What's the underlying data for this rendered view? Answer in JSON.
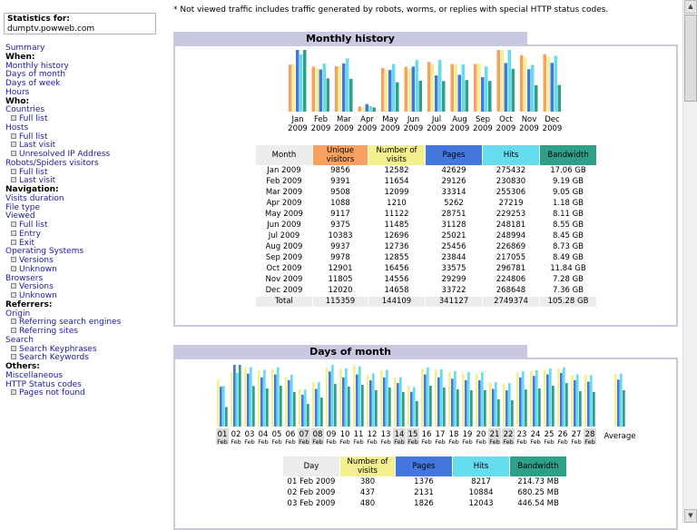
{
  "sidebar": {
    "stats_label": "Statistics for:",
    "site": "dumptv.powweb.com",
    "menu": [
      {
        "type": "link",
        "text": "Summary"
      },
      {
        "type": "head",
        "text": "When:"
      },
      {
        "type": "link",
        "text": "Monthly history"
      },
      {
        "type": "link",
        "text": "Days of month"
      },
      {
        "type": "link",
        "text": "Days of week"
      },
      {
        "type": "link",
        "text": "Hours"
      },
      {
        "type": "head",
        "text": "Who:"
      },
      {
        "type": "link",
        "text": "Countries"
      },
      {
        "type": "sub",
        "text": "Full list"
      },
      {
        "type": "link",
        "text": "Hosts"
      },
      {
        "type": "sub",
        "text": "Full list"
      },
      {
        "type": "sub",
        "text": "Last visit"
      },
      {
        "type": "sub",
        "text": "Unresolved IP Address"
      },
      {
        "type": "link",
        "text": "Robots/Spiders visitors"
      },
      {
        "type": "sub",
        "text": "Full list"
      },
      {
        "type": "sub",
        "text": "Last visit"
      },
      {
        "type": "head",
        "text": "Navigation:"
      },
      {
        "type": "link",
        "text": "Visits duration"
      },
      {
        "type": "link",
        "text": "File type"
      },
      {
        "type": "link",
        "text": "Viewed"
      },
      {
        "type": "sub",
        "text": "Full list"
      },
      {
        "type": "sub",
        "text": "Entry"
      },
      {
        "type": "sub",
        "text": "Exit"
      },
      {
        "type": "link",
        "text": "Operating Systems"
      },
      {
        "type": "sub",
        "text": "Versions"
      },
      {
        "type": "sub",
        "text": "Unknown"
      },
      {
        "type": "link",
        "text": "Browsers"
      },
      {
        "type": "sub",
        "text": "Versions"
      },
      {
        "type": "sub",
        "text": "Unknown"
      },
      {
        "type": "head",
        "text": "Referrers:"
      },
      {
        "type": "link",
        "text": "Origin"
      },
      {
        "type": "sub",
        "text": "Referring search engines"
      },
      {
        "type": "sub",
        "text": "Referring sites"
      },
      {
        "type": "link",
        "text": "Search"
      },
      {
        "type": "sub",
        "text": "Search Keyphrases"
      },
      {
        "type": "sub",
        "text": "Search Keywords"
      },
      {
        "type": "head",
        "text": "Others:"
      },
      {
        "type": "link",
        "text": "Miscellaneous"
      },
      {
        "type": "link",
        "text": "HTTP Status codes"
      },
      {
        "type": "sub",
        "text": "Pages not found"
      }
    ]
  },
  "note": "* Not viewed traffic includes traffic generated by robots, worms, or replies with special HTTP status codes.",
  "monthly": {
    "title": "Monthly history",
    "headers": [
      "Month",
      "Unique visitors",
      "Number of visits",
      "Pages",
      "Hits",
      "Bandwidth"
    ],
    "rows": [
      [
        "Jan 2009",
        "9856",
        "12582",
        "42629",
        "275432",
        "17.06 GB"
      ],
      [
        "Feb 2009",
        "9391",
        "11654",
        "29126",
        "230830",
        "9.19 GB"
      ],
      [
        "Mar 2009",
        "9508",
        "12099",
        "33314",
        "255306",
        "9.05 GB"
      ],
      [
        "Apr 2009",
        "1088",
        "1210",
        "5262",
        "27219",
        "1.18 GB"
      ],
      [
        "May 2009",
        "9117",
        "11122",
        "28751",
        "229253",
        "8.11 GB"
      ],
      [
        "Jun 2009",
        "9375",
        "11485",
        "31128",
        "248181",
        "8.55 GB"
      ],
      [
        "Jul 2009",
        "10383",
        "12696",
        "25021",
        "248994",
        "8.45 GB"
      ],
      [
        "Aug 2009",
        "9937",
        "12736",
        "25456",
        "226869",
        "8.73 GB"
      ],
      [
        "Sep 2009",
        "9978",
        "12855",
        "23844",
        "217055",
        "8.49 GB"
      ],
      [
        "Oct 2009",
        "12901",
        "16456",
        "33575",
        "296781",
        "11.84 GB"
      ],
      [
        "Nov 2009",
        "11805",
        "14556",
        "29299",
        "224806",
        "7.28 GB"
      ],
      [
        "Dec 2009",
        "12020",
        "14658",
        "33722",
        "268648",
        "7.36 GB"
      ]
    ],
    "total": [
      "Total",
      "115359",
      "144109",
      "341127",
      "2749374",
      "105.28 GB"
    ]
  },
  "days": {
    "title": "Days of month",
    "headers": [
      "Day",
      "Number of visits",
      "Pages",
      "Hits",
      "Bandwidth"
    ],
    "rows": [
      [
        "01 Feb 2009",
        "380",
        "1376",
        "8217",
        "214.73 MB"
      ],
      [
        "02 Feb 2009",
        "437",
        "2131",
        "10884",
        "680.25 MB"
      ],
      [
        "03 Feb 2009",
        "480",
        "1826",
        "12043",
        "446.54 MB"
      ]
    ],
    "average_label": "Average"
  },
  "chart_data": [
    {
      "type": "bar",
      "title": "Monthly history",
      "categories": [
        "Jan 2009",
        "Feb 2009",
        "Mar 2009",
        "Apr 2009",
        "May 2009",
        "Jun 2009",
        "Jul 2009",
        "Aug 2009",
        "Sep 2009",
        "Oct 2009",
        "Nov 2009",
        "Dec 2009"
      ],
      "series": [
        {
          "name": "Unique visitors",
          "color": "#f8a060",
          "values": [
            9856,
            9391,
            9508,
            1088,
            9117,
            9375,
            10383,
            9937,
            9978,
            12901,
            11805,
            12020
          ]
        },
        {
          "name": "Number of visits",
          "color": "#f4f090",
          "values": [
            12582,
            11654,
            12099,
            1210,
            11122,
            11485,
            12696,
            12736,
            12855,
            16456,
            14556,
            14658
          ]
        },
        {
          "name": "Pages",
          "color": "#4477dd",
          "values": [
            42629,
            29126,
            33314,
            5262,
            28751,
            31128,
            25021,
            25456,
            23844,
            33575,
            29299,
            33722
          ]
        },
        {
          "name": "Hits",
          "color": "#66ddee",
          "values": [
            275432,
            230830,
            255306,
            27219,
            229253,
            248181,
            248994,
            226869,
            217055,
            296781,
            224806,
            268648
          ]
        },
        {
          "name": "Bandwidth",
          "color": "#2ea08a",
          "values": [
            17.06,
            9.19,
            9.05,
            1.18,
            8.11,
            8.55,
            8.45,
            8.73,
            8.49,
            11.84,
            7.28,
            7.36
          ]
        }
      ]
    },
    {
      "type": "bar",
      "title": "Days of month",
      "categories": [
        "01",
        "02",
        "03",
        "04",
        "05",
        "06",
        "07",
        "08",
        "09",
        "10",
        "11",
        "12",
        "13",
        "14",
        "15",
        "16",
        "17",
        "18",
        "19",
        "20",
        "21",
        "22",
        "23",
        "24",
        "25",
        "26",
        "27",
        "28"
      ],
      "month_label": "Feb",
      "weekend_days": [
        "01",
        "07",
        "08",
        "14",
        "15",
        "21",
        "22",
        "28"
      ],
      "series": [
        {
          "name": "Number of visits",
          "color": "#f4f090",
          "values": [
            380,
            437,
            480,
            460,
            470,
            400,
            300,
            360,
            480,
            470,
            500,
            420,
            460,
            400,
            330,
            470,
            460,
            440,
            430,
            430,
            360,
            350,
            440,
            450,
            460,
            470,
            420,
            420
          ]
        },
        {
          "name": "Pages",
          "color": "#4477dd",
          "values": [
            1376,
            2131,
            1826,
            1700,
            1800,
            1600,
            1100,
            1300,
            1900,
            1700,
            1800,
            1600,
            1700,
            1500,
            1200,
            1800,
            1700,
            1650,
            1600,
            1600,
            1300,
            1250,
            1700,
            1750,
            1800,
            1850,
            1600,
            1550
          ]
        },
        {
          "name": "Hits",
          "color": "#66ddee",
          "values": [
            8217,
            10884,
            12043,
            11500,
            12000,
            10500,
            7500,
            9000,
            12500,
            11800,
            12200,
            10800,
            11500,
            10000,
            8000,
            12000,
            11600,
            11200,
            11000,
            11000,
            9000,
            8800,
            11200,
            11400,
            11800,
            12000,
            10600,
            10400
          ]
        },
        {
          "name": "Bandwidth",
          "color": "#2ea08a",
          "values": [
            214.73,
            680.25,
            446.54,
            420,
            450,
            380,
            250,
            320,
            470,
            440,
            460,
            400,
            430,
            380,
            280,
            450,
            430,
            410,
            400,
            400,
            300,
            290,
            410,
            420,
            450,
            480,
            390,
            380
          ]
        }
      ]
    }
  ]
}
